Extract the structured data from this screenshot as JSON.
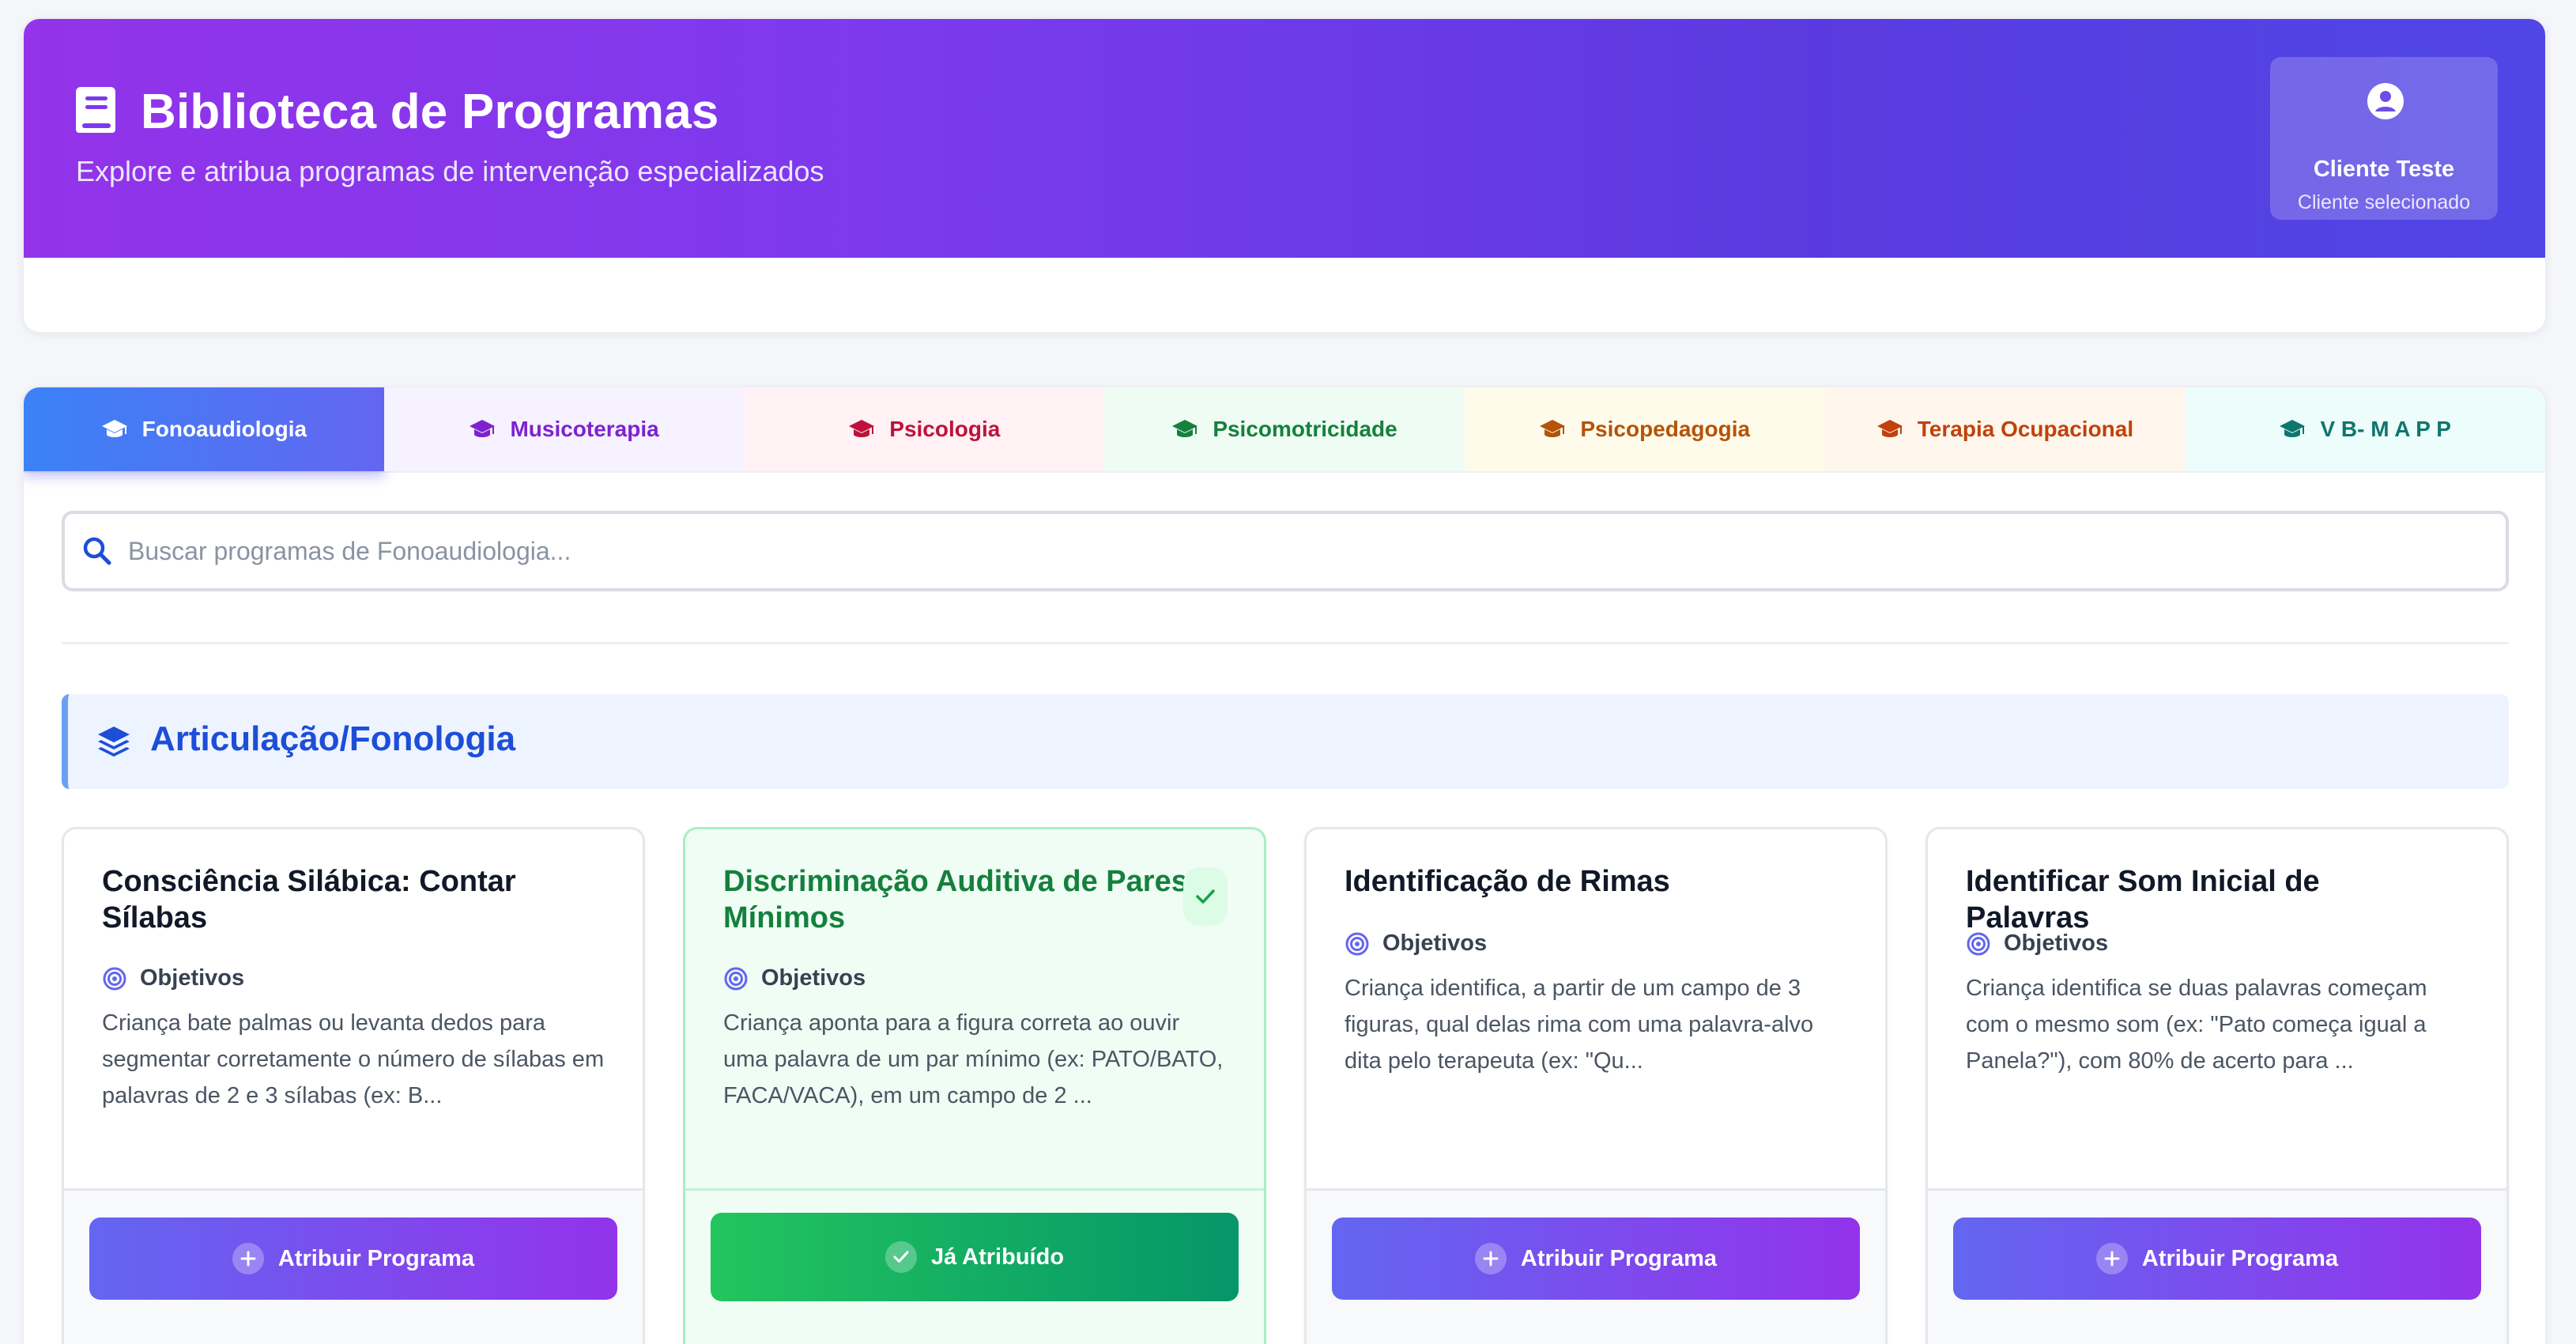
{
  "header": {
    "title": "Biblioteca de Programas",
    "subtitle": "Explore e atribua programas de intervenção especializados",
    "client": {
      "name": "Cliente Teste",
      "status": "Cliente selecionado",
      "icon": "user-circle-icon"
    },
    "icon": "book-icon"
  },
  "tabs": [
    {
      "label": "Fonoaudiologia",
      "active": true,
      "color": "#ffffff",
      "bg": "#3b82f6"
    },
    {
      "label": "Musicoterapia",
      "active": false,
      "color": "#7e22ce",
      "bg": "#f6f2ff"
    },
    {
      "label": "Psicologia",
      "active": false,
      "color": "#be123c",
      "bg": "#fff1f4"
    },
    {
      "label": "Psicomotricidade",
      "active": false,
      "color": "#15803d",
      "bg": "#effcf3"
    },
    {
      "label": "Psicopedagogia",
      "active": false,
      "color": "#b45309",
      "bg": "#fffbeb"
    },
    {
      "label": "Terapia Ocupacional",
      "active": false,
      "color": "#c2410c",
      "bg": "#fff7ed"
    },
    {
      "label": "V B- M A P P",
      "active": false,
      "color": "#0f766e",
      "bg": "#ecfdfb"
    }
  ],
  "search": {
    "placeholder": "Buscar programas de Fonoaudiologia...",
    "value": ""
  },
  "section": {
    "title": "Articulação/Fonologia",
    "icon": "layers-icon"
  },
  "objectives_label": "Objetivos",
  "cards": [
    {
      "title": "Consciência Silábica: Contar Sílabas",
      "description": "Criança bate palmas ou levanta dedos para segmentar corretamente o número de sílabas em palavras de 2 e 3 sílabas (ex: B...",
      "button": "Atribuir Programa",
      "assigned": false
    },
    {
      "title": "Discriminação Auditiva de Pares Mínimos",
      "description": "Criança aponta para a figura correta ao ouvir uma palavra de um par mínimo (ex: PATO/BATO, FACA/VACA), em um campo de 2 ...",
      "button": "Já Atribuído",
      "assigned": true
    },
    {
      "title": "Identificação de Rimas",
      "description": "Criança identifica, a partir de um campo de 3 figuras, qual delas rima com uma palavra-alvo dita pelo terapeuta (ex: \"Qu...",
      "button": "Atribuir Programa",
      "assigned": false
    },
    {
      "title": "Identificar Som Inicial de Palavras",
      "description": "Criança identifica se duas palavras começam com o mesmo som (ex: \"Pato começa igual a Panela?\"), com 80% de acerto para ...",
      "button": "Atribuir Programa",
      "assigned": false
    }
  ]
}
